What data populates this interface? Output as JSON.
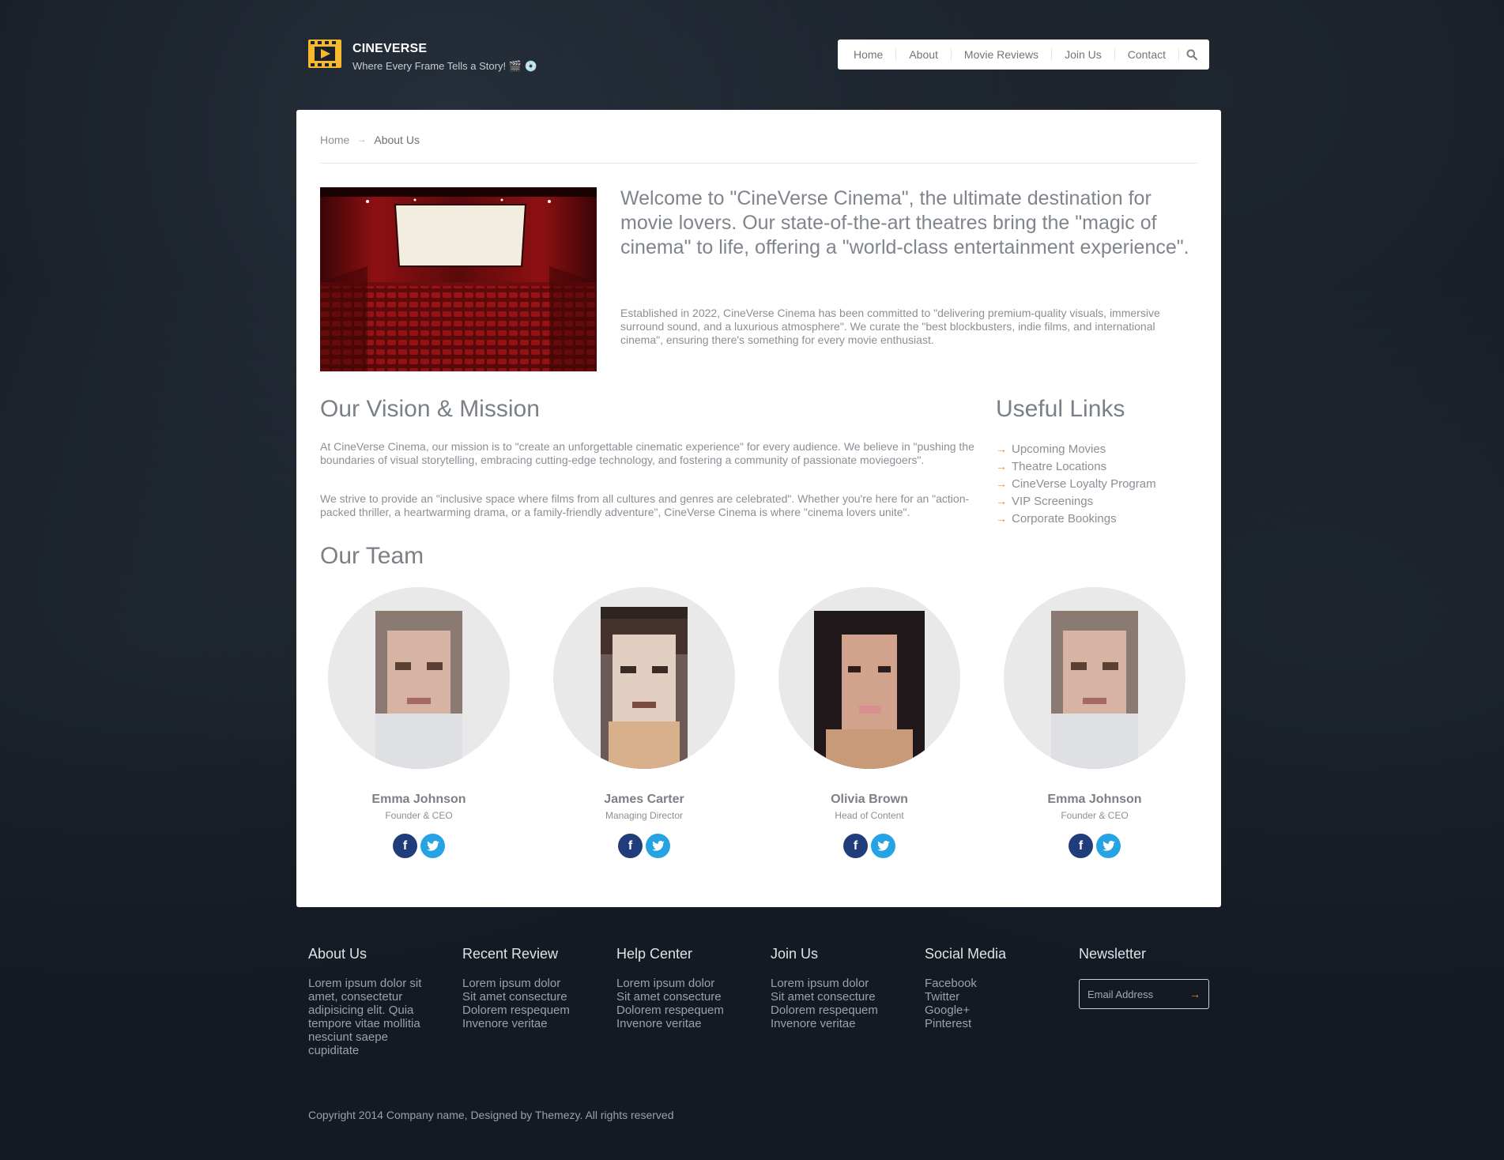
{
  "brand": {
    "title": "CINEVERSE",
    "tagline": "Where Every Frame Tells a Story! 🎬 💿",
    "accent": "#f5b82e"
  },
  "nav": {
    "items": [
      "Home",
      "About",
      "Movie Reviews",
      "Join Us",
      "Contact"
    ],
    "search_icon": "search-icon"
  },
  "breadcrumb": {
    "home": "Home",
    "current": "About Us"
  },
  "intro": {
    "lead": "Welcome to \"CineVerse Cinema\", the ultimate destination for movie lovers. Our state-of-the-art theatres bring the \"magic of cinema\" to life, offering a \"world-class entertainment experience\".",
    "body": "Established in 2022, CineVerse Cinema has been committed to \"delivering premium-quality visuals, immersive surround sound, and a luxurious atmosphere\". We curate the \"best blockbusters, indie films, and international cinema\", ensuring there's something for every movie enthusiast."
  },
  "vision": {
    "title": "Our Vision & Mission",
    "p1": "At CineVerse Cinema, our mission is to \"create an unforgettable cinematic experience\" for every audience. We believe in \"pushing the boundaries of visual storytelling, embracing cutting-edge technology, and fostering a community of passionate moviegoers\".",
    "p2": "We strive to provide an \"inclusive space where films from all cultures and genres are celebrated\". Whether you're here for an \"action-packed thriller, a heartwarming drama, or a family-friendly adventure\", CineVerse Cinema is where \"cinema lovers unite\"."
  },
  "useful_links": {
    "title": "Useful Links",
    "items": [
      "Upcoming Movies",
      "Theatre Locations",
      "CineVerse Loyalty Program",
      "VIP Screenings",
      "Corporate Bookings"
    ]
  },
  "team": {
    "title": "Our Team",
    "members": [
      {
        "name": "Emma Johnson",
        "role": "Founder & CEO"
      },
      {
        "name": "James Carter",
        "role": "Managing Director"
      },
      {
        "name": "Olivia Brown",
        "role": "Head of Content"
      },
      {
        "name": "Emma Johnson",
        "role": "Founder & CEO"
      }
    ]
  },
  "footer": {
    "columns": [
      {
        "title": "About Us",
        "lines": [
          "Lorem ipsum dolor sit",
          "amet, consectetur",
          "adipisicing elit. Quia",
          "tempore vitae mollitia",
          "nesciunt saepe",
          "cupiditate"
        ]
      },
      {
        "title": "Recent Review",
        "lines": [
          "Lorem ipsum dolor",
          "Sit amet consecture",
          "Dolorem respequem",
          "Invenore veritae"
        ]
      },
      {
        "title": "Help Center",
        "lines": [
          "Lorem ipsum dolor",
          "Sit amet consecture",
          "Dolorem respequem",
          "Invenore veritae"
        ]
      },
      {
        "title": "Join Us",
        "lines": [
          "Lorem ipsum dolor",
          "Sit amet consecture",
          "Dolorem respequem",
          "Invenore veritae"
        ]
      },
      {
        "title": "Social Media",
        "lines": [
          "Facebook",
          "Twitter",
          "Google+",
          "Pinterest"
        ]
      },
      {
        "title": "Newsletter",
        "lines": []
      }
    ],
    "newsletter_placeholder": "Email Address",
    "copyright": "Copyright 2014 Company name, Designed by Themezy. All rights reserved"
  },
  "colors": {
    "link_arrow": "#e8913a",
    "facebook": "#213c7a",
    "twitter": "#26a3e3"
  }
}
